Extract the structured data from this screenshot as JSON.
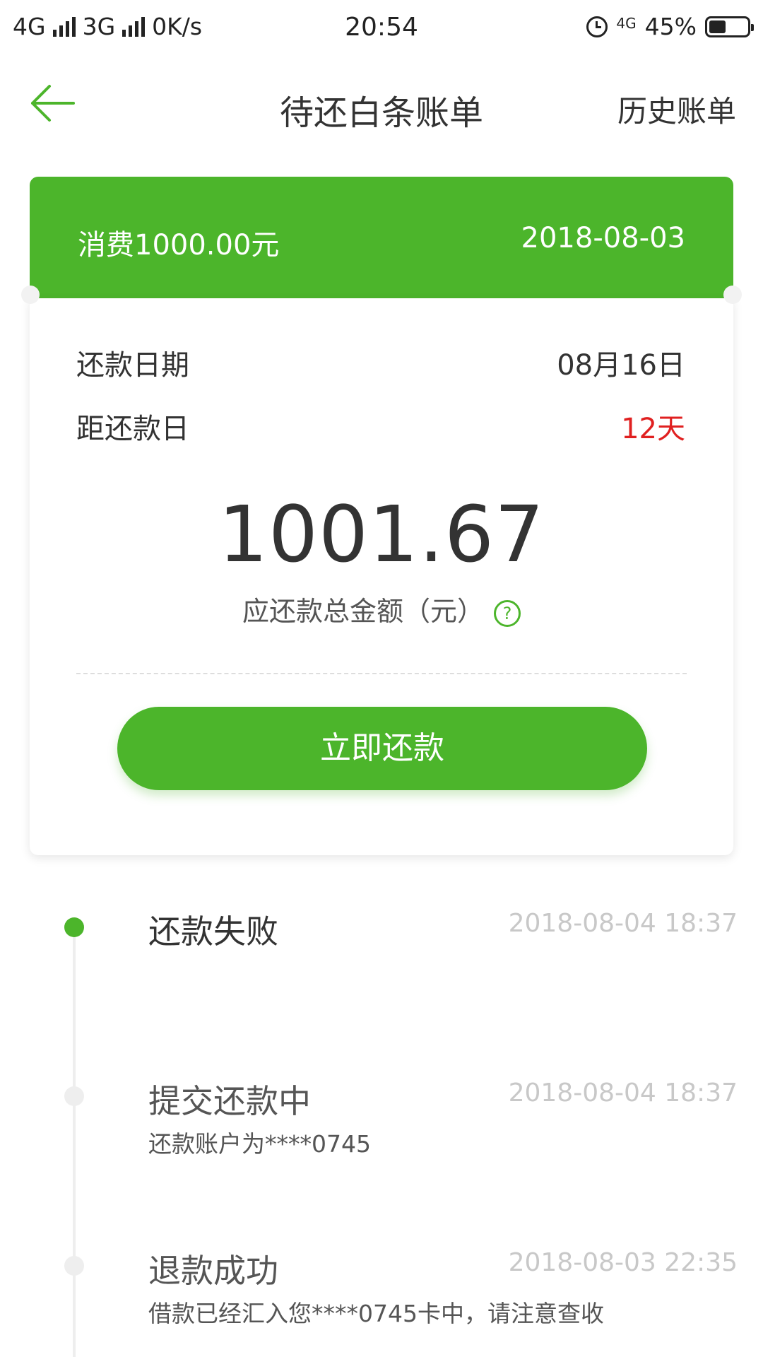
{
  "status_bar": {
    "net1": "4G",
    "net2": "3G",
    "speed": "0K/s",
    "time": "20:54",
    "net_small": "4G",
    "battery": "45%"
  },
  "header": {
    "title": "待还白条账单",
    "history": "历史账单"
  },
  "bill": {
    "consume": "消费1000.00元",
    "date": "2018-08-03",
    "repay_date_label": "还款日期",
    "repay_date_value": "08月16日",
    "days_left_label": "距还款日",
    "days_left_value": "12天",
    "amount": "1001.67",
    "amount_label": "应还款总金额（元）",
    "help_icon": "question-circle-icon",
    "pay_button": "立即还款"
  },
  "timeline": [
    {
      "title": "还款失败",
      "time": "2018-08-04 18:37",
      "desc": "",
      "active": true
    },
    {
      "title": "提交还款中",
      "time": "2018-08-04 18:37",
      "desc": "还款账户为****0745",
      "active": false
    },
    {
      "title": "退款成功",
      "time": "2018-08-03 22:35",
      "desc": "借款已经汇入您****0745卡中，请注意查收",
      "active": false
    }
  ],
  "colors": {
    "accent": "#4cb52b",
    "warning": "#e02020",
    "muted": "#c8c8c8"
  }
}
